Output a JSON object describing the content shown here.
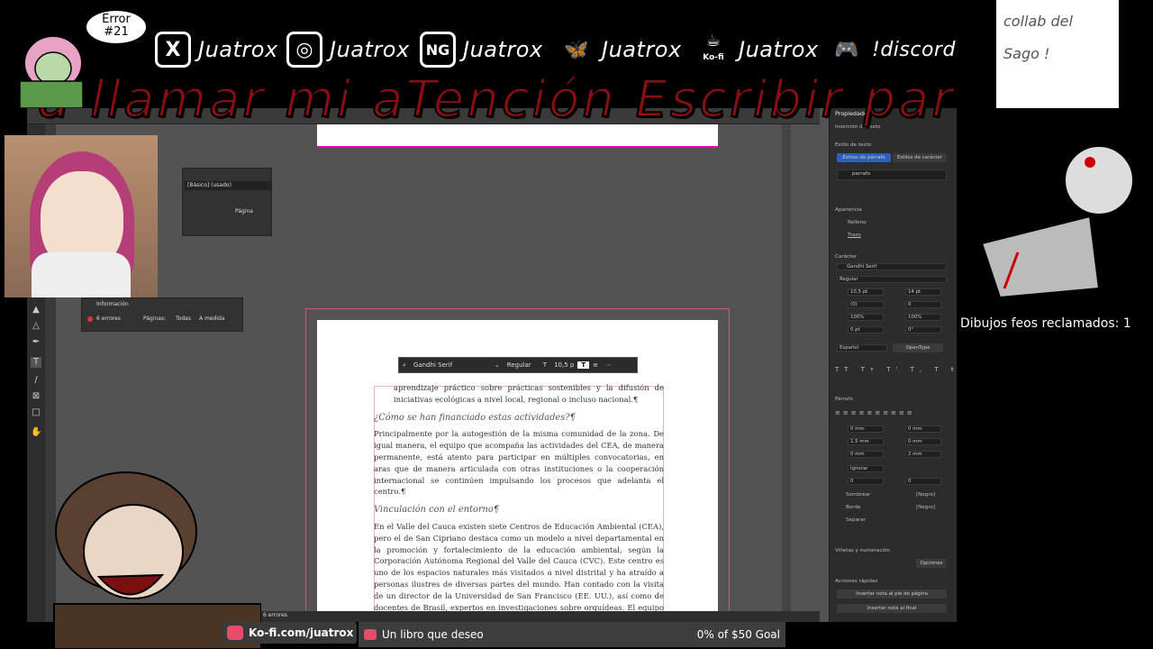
{
  "overlay": {
    "error_badge": "Error\n#21",
    "scroll_text": "a llamar mi aTención Escribir par",
    "socials": [
      {
        "icon": "x-logo-icon",
        "glyph": "X",
        "name": "Juatrox"
      },
      {
        "icon": "instagram-icon",
        "glyph": "◎",
        "name": "Juatrox"
      },
      {
        "icon": "newgrounds-icon",
        "glyph": "NG",
        "name": "Juatrox"
      },
      {
        "icon": "bluesky-butterfly-icon",
        "glyph": "🦋",
        "name": "Juatrox"
      },
      {
        "icon": "kofi-cup-icon",
        "glyph": "☕",
        "name": "Juatrox",
        "sub": "Ko-fi"
      },
      {
        "icon": "gamepad-icon",
        "glyph": "🎮",
        "name": "!discord"
      }
    ],
    "claims_label": "Dibujos feos reclamados: 1",
    "kofi_link": "Ko-fi.com/juatrox",
    "goal_text": "Un libro que deseo",
    "goal_progress": "0% of $50 Goal",
    "sketch_text": "collab del Sago !"
  },
  "indesign": {
    "control_font": "Gandhi Serif",
    "control_style": "Regular",
    "control_size": "10,5 p",
    "panel_left": {
      "field": "[Básico] (usado)",
      "tab": "Página"
    },
    "info_panel": {
      "title": "Información",
      "errors": "6 errores",
      "pages": "Páginas:",
      "all": "Todas",
      "custom": "A medida"
    },
    "status_errors": "6 errores",
    "properties": {
      "title": "Propiedades",
      "subtitle": "Inserción de texto",
      "text_styles": "Estilo de texto",
      "para_styles_btn": "Estilos de párrafo",
      "char_styles_btn": "Estilos de carácter",
      "para_style": "parrafo",
      "appearance": "Apariencia",
      "fill": "Relleno",
      "stroke": "Trazo",
      "character": "Carácter",
      "font": "Gandhi Serif",
      "font_style": "Regular",
      "size": "10,5 pt",
      "leading": "14 pt",
      "kerning": "(0)",
      "tracking": "0",
      "vscale": "100%",
      "hscale": "100%",
      "baseline": "0 pt",
      "skew": "0°",
      "language": "Español",
      "opentype": "OpenType",
      "paragraph": "Párrafo",
      "indent_l": "0 mm",
      "indent_r": "0 mm",
      "first_line": "1,5 mm",
      "last_line": "0 mm",
      "space_before": "0 mm",
      "space_after": "2 mm",
      "grid": "Ignorar",
      "drop1": "0",
      "drop2": "0",
      "shading": "Sombrear",
      "border": "Borde",
      "separator": "Separar",
      "black1": "[Negro]",
      "black2": "[Negro]",
      "bullets": "Viñetas y numeración",
      "options": "Opciones",
      "quick": "Acciones rápidas",
      "footnote": "Insertar nota al pie de página",
      "endnote": "Insertar nota al final"
    }
  },
  "document": {
    "p0": "aprendizaje práctico sobre prácticas sostenibles y la difusión de iniciativas ecológicas a nivel local, regional o incluso nacional.¶",
    "h1": "¿Cómo se han financiado estas actividades?¶",
    "p1": "Principalmente por la autogestión de la misma comunidad de la zona. De igual manera, el equipo que acompaña las actividades del CEA, de manera permanente, está atento para participar en múltiples convocatorias, en aras que de manera articulada con otras instituciones o la cooperación internacional se continúen impulsando los procesos que adelanta el centro.¶",
    "h2": "Vinculación con el entorno¶",
    "p2": "En el Valle del Cauca existen siete Centros de Educación Ambiental (CEA), pero el de San Cipriano destaca como un modelo a nivel departamental en la promoción y fortalecimiento de la educación ambiental, según la Corporación Autónoma Regional del Valle del Cauca (CVC). Este centro es uno de los espacios naturales más visitados a nivel distrital y ha atraído a personas ilustres de diversas partes del mundo. Han contado con la visita de un director de la Universidad de San Francisco (EE. UU.), así como de docentes de Brasil, expertos en investigaciones sobre orquídeas. El equipo del CEA, como buenos anfitriones, los acompañó a recorrer la Reserva Protectora"
  }
}
